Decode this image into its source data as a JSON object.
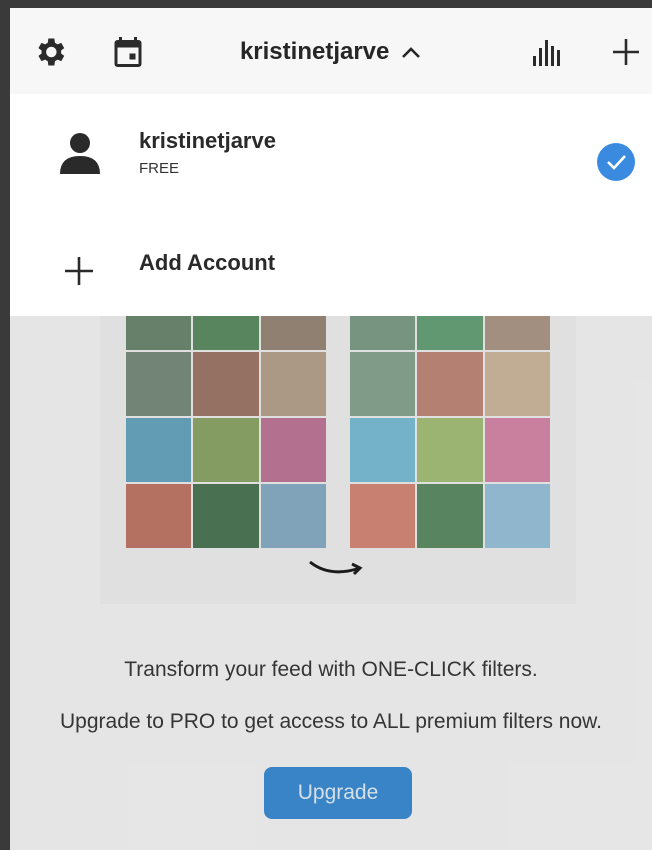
{
  "toolbar": {
    "account_title": "kristinetjarve",
    "icons": [
      "gear-icon",
      "calendar-icon",
      "chevron-up-icon",
      "bar-chart-icon",
      "plus-icon"
    ]
  },
  "dropdown": {
    "account": {
      "name": "kristinetjarve",
      "plan": "FREE",
      "selected": true
    },
    "add_account_label": "Add Account"
  },
  "promo": {
    "line1": "Transform your feed with ONE-CLICK filters.",
    "line2": "Upgrade to PRO to get access to ALL premium filters now.",
    "upgrade_label": "Upgrade"
  },
  "colors": {
    "accent": "#3d8fd6",
    "check": "#3a8be0"
  }
}
